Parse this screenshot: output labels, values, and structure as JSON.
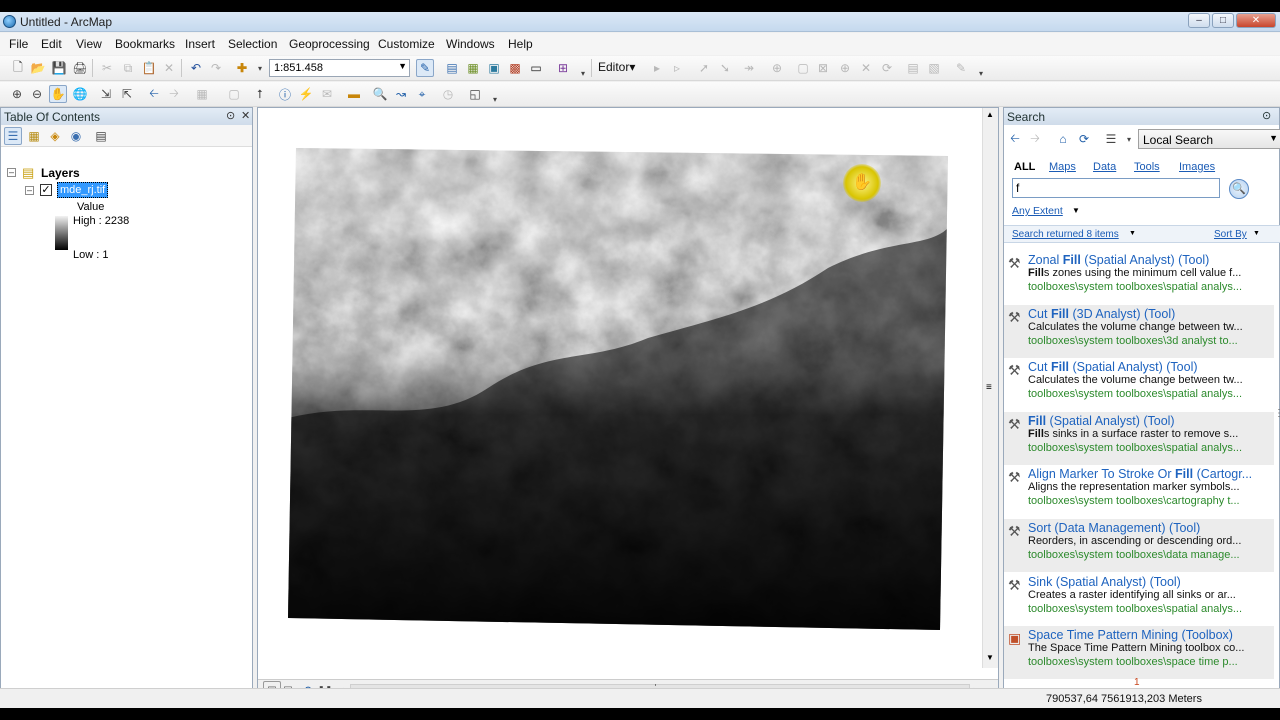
{
  "window": {
    "title": "Untitled - ArcMap"
  },
  "menu": [
    "File",
    "Edit",
    "View",
    "Bookmarks",
    "Insert",
    "Selection",
    "Geoprocessing",
    "Customize",
    "Windows",
    "Help"
  ],
  "toolbar": {
    "scale": "1:851.458",
    "editor_label": "Editor▾"
  },
  "toc": {
    "title": "Table Of Contents",
    "root_label": "Layers",
    "layer_name": "mde_rj.tif",
    "legend_title": "Value",
    "high_label": "High : 2238",
    "low_label": "Low : 1"
  },
  "search": {
    "title": "Search",
    "scope": "Local Search",
    "filters": [
      "ALL",
      "Maps",
      "Data",
      "Tools",
      "Images"
    ],
    "query": "f",
    "extent": "Any Extent",
    "returned": "Search returned 8 items",
    "sort": "Sort By",
    "page_number": "1",
    "results": [
      {
        "pre": "Zonal ",
        "hit": "Fill",
        "post": " (Spatial Analyst) (Tool)",
        "desc_hit": "Fill",
        "desc": "s zones using the minimum cell value f...",
        "path": "toolboxes\\system toolboxes\\spatial analys...",
        "alt": false,
        "icon": "hammer-icon"
      },
      {
        "pre": "Cut ",
        "hit": "Fill",
        "post": " (3D Analyst) (Tool)",
        "desc_hit": "",
        "desc": "Calculates the volume change between tw...",
        "path": "toolboxes\\system toolboxes\\3d analyst to...",
        "alt": true,
        "icon": "hammer-icon"
      },
      {
        "pre": "Cut ",
        "hit": "Fill",
        "post": " (Spatial Analyst) (Tool)",
        "desc_hit": "",
        "desc": "Calculates the volume change between tw...",
        "path": "toolboxes\\system toolboxes\\spatial analys...",
        "alt": false,
        "icon": "hammer-icon"
      },
      {
        "pre": "",
        "hit": "Fill",
        "post": " (Spatial Analyst) (Tool)",
        "desc_hit": "Fill",
        "desc": "s sinks in a surface raster to remove s...",
        "path": "toolboxes\\system toolboxes\\spatial analys...",
        "alt": true,
        "icon": "hammer-icon"
      },
      {
        "pre": "Align Marker To Stroke Or ",
        "hit": "Fill",
        "post": " (Cartogr...",
        "desc_hit": "",
        "desc": "Aligns the representation marker symbols...",
        "path": "toolboxes\\system toolboxes\\cartography t...",
        "alt": false,
        "icon": "hammer-icon"
      },
      {
        "pre": "Sort (Data Management) (Tool)",
        "hit": "",
        "post": "",
        "desc_hit": "",
        "desc": "Reorders, in ascending or descending ord...",
        "path": "toolboxes\\system toolboxes\\data manage...",
        "alt": true,
        "icon": "hammer-icon"
      },
      {
        "pre": "Sink (Spatial Analyst) (Tool)",
        "hit": "",
        "post": "",
        "desc_hit": "",
        "desc": "Creates a raster identifying all sinks or ar...",
        "path": "toolboxes\\system toolboxes\\spatial analys...",
        "alt": false,
        "icon": "hammer-icon"
      },
      {
        "pre": "Space Time Pattern Mining (Toolbox)",
        "hit": "",
        "post": "",
        "desc_hit": "",
        "desc": "The Space Time Pattern Mining toolbox co...",
        "path": "toolboxes\\system toolboxes\\space time p...",
        "alt": true,
        "icon": "toolbox-icon"
      }
    ]
  },
  "status": {
    "coords": "790537,64  7561913,203 Meters"
  }
}
